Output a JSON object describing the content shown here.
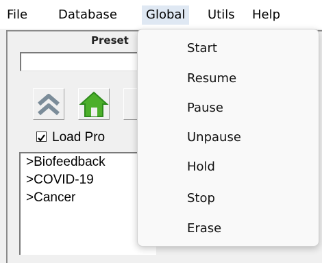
{
  "menubar": {
    "items": [
      "File",
      "Database",
      "Global",
      "Utils",
      "Help"
    ]
  },
  "panel": {
    "title": "Preset",
    "load_label": "Load Pro",
    "load_checked": true,
    "list_items": [
      ">Biofeedback",
      ">COVID-19",
      ">Cancer"
    ]
  },
  "dropdown": {
    "items": [
      "Start",
      "Resume",
      "Pause",
      "Unpause",
      "Hold",
      "Stop",
      "Erase"
    ]
  },
  "icons": {
    "up": "double-chevron-up-icon",
    "home": "home-icon"
  },
  "colors": {
    "chevron": "#7b8c99",
    "home_green": "#4caf2a",
    "home_roof": "#2e8a1c",
    "active_menu_bg": "#dfe8f3"
  }
}
